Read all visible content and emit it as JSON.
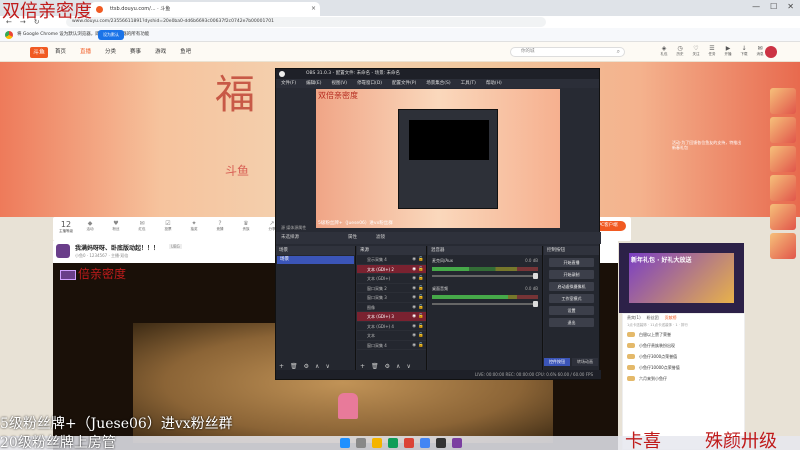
{
  "browser": {
    "tab_title": "ttsb.douyu.com/... · 斗鱼",
    "url": "www.douyu.com/23556611891?dyshid=20e0ba0-dd6b6693c00637f2c0742e7b00001701",
    "banner_text": "将 Google Chrome 设为默认浏览器，即可畅享浏览器的所有功能",
    "set_default_label": "设为默认",
    "controls": [
      "—",
      "☐",
      "✕"
    ]
  },
  "site": {
    "logo": "斗鱼",
    "nav": [
      "首页",
      "直播",
      "分类",
      "赛事",
      "游戏",
      "鱼吧"
    ],
    "search_placeholder": "你的城",
    "user_icons": [
      {
        "icon": "gift-icon",
        "label": "礼包"
      },
      {
        "icon": "history-icon",
        "label": "历史"
      },
      {
        "icon": "follow-icon",
        "label": "关注"
      },
      {
        "icon": "tasks-icon",
        "label": "任务"
      },
      {
        "icon": "live-icon",
        "label": "开播"
      },
      {
        "icon": "download-icon",
        "label": "下载"
      },
      {
        "icon": "message-icon",
        "label": "消息"
      }
    ]
  },
  "room": {
    "level": "12",
    "level_sub": "主播等级",
    "actions": [
      "活动",
      "粉丝",
      "红包",
      "投票",
      "抽奖",
      "竞猜",
      "贵族",
      "分享",
      "音乐",
      "赛事",
      "排行",
      "礼物",
      "公告",
      "更多",
      "福利"
    ],
    "pc_button": "PC客户端"
  },
  "stream": {
    "title": "我满妈呀呀、卧底版动起！！！",
    "meta": "小鱼0 · 1234567 · 主播·双倍",
    "tag": "UBG"
  },
  "obs": {
    "title": "OBS 31.0.3 - 配置文件: 未命名 - 场景: 未命名",
    "menu": [
      "文件(F)",
      "编辑(E)",
      "视图(V)",
      "停靠窗口(D)",
      "配置文件(P)",
      "场景集合(S)",
      "工具(T)",
      "帮助(H)"
    ],
    "preview_title": "双倍亲密度",
    "preview_sub": "5级粉丝牌+（Juese06）进vx粉丝群",
    "under_preview": "源  媒体源属性",
    "props_row": [
      "未选择源",
      "属性",
      "滤镜"
    ],
    "scenes_header": "场景",
    "scenes": [
      "场景"
    ],
    "sources_header": "来源",
    "sources": [
      {
        "name": "显示采集 4",
        "active": false
      },
      {
        "name": "文本 (GDI+) 2",
        "active": true
      },
      {
        "name": "文本 (GDI+)",
        "active": false
      },
      {
        "name": "窗口采集 2",
        "active": false
      },
      {
        "name": "窗口采集 3",
        "active": false
      },
      {
        "name": "图像",
        "active": false
      },
      {
        "name": "文本 (GDI+) 3",
        "active": true
      },
      {
        "name": "文本 (GDI+) 4",
        "active": false
      },
      {
        "name": "文本",
        "active": false
      },
      {
        "name": "窗口采集 4",
        "active": false
      }
    ],
    "mixer_header": "混音器",
    "mixer": [
      {
        "name": "麦克风/Aux",
        "db": "0.0 dB",
        "level": 0.35
      },
      {
        "name": "桌面音频",
        "db": "0.0 dB",
        "level": 0.72
      }
    ],
    "controls_header": "控制按钮",
    "controls": [
      "开始直播",
      "开始录制",
      "启动虚拟摄像机",
      "工作室模式",
      "设置",
      "退出"
    ],
    "bottom_tabs": [
      "控件按钮",
      "转场动画"
    ],
    "status": "LIVE: 00:00:00   REC: 00:00:00   CPU: 0.6%   60.00 / 60.00 FPS"
  },
  "right_panel": {
    "title": "新年礼包 · 好礼大放送",
    "desc": "活动·为了回馈各位鱼友的支持，特推出新春礼包",
    "fans_tabs": [
      "贵宾(1)",
      "粉丝团",
      "贡献榜"
    ],
    "fans_sub": "1点卡送装饰 · 11点卡送装饰 · 1 · 排行",
    "fans": [
      "白银以上赞了荣誉",
      "小鱼仔贵族装扮出现",
      "小鱼仔3000点荣誉值",
      "小鱼仔10000点荣誉值",
      "六月来到小鱼仔"
    ]
  },
  "overlay": {
    "top_left": "双倍亲密度",
    "mid": "倍亲密度",
    "line1": "5级粉丝牌+（Juese06）进vx粉丝群",
    "line2": "20级粉丝牌上房管",
    "bottom_right_1": "卡喜",
    "bottom_right_2": "殊颜卅级"
  },
  "banner_chars": [
    "福",
    "斗鱼"
  ],
  "colors": {
    "accent": "#f15a22",
    "watermark": "#c01b1b",
    "obs_bg": "#272a33",
    "obs_selected": "#3b55b8"
  }
}
